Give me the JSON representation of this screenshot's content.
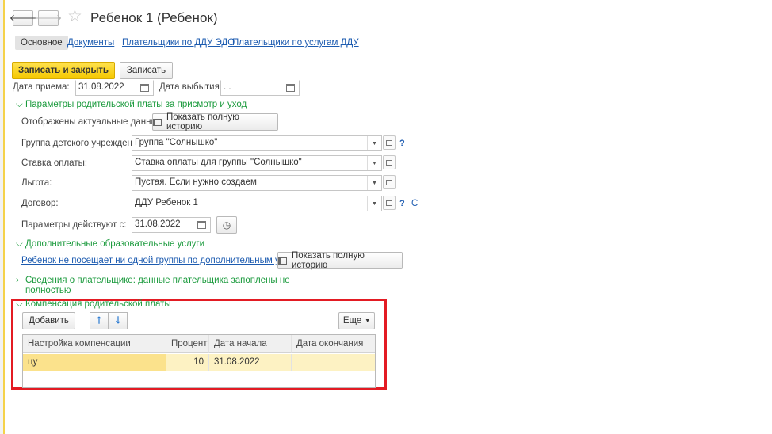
{
  "window": {
    "title": "Ребенок 1 (Ребенок)"
  },
  "nav": {
    "back": "🡐",
    "forward": "🡒"
  },
  "tabs": [
    {
      "label": "Основное"
    },
    {
      "label": "Документы"
    },
    {
      "label": "Плательщики по ДДУ ЭДО"
    },
    {
      "label": "Плательщики по услугам ДДУ"
    }
  ],
  "toolbar": {
    "save_close": "Записать и закрыть",
    "save": "Записать"
  },
  "dates": {
    "admit_label": "Дата приема:",
    "admit_value": "31.08.2022",
    "leave_label": "Дата выбытия:",
    "leave_value": ". ."
  },
  "fee_section": {
    "title": "Параметры родительской платы за присмотр и уход",
    "actual_text": "Отображены актуальные данные",
    "history_btn": "Показать полную историю",
    "group_label": "Группа детского учреждения:",
    "group_value": "Группа \"Солнышко\"",
    "rate_label": "Ставка оплаты:",
    "rate_value": "Ставка оплаты для группы \"Солнышко\"",
    "benefit_label": "Льгота:",
    "benefit_value": "Пустая. Если нужно создаем",
    "contract_label": "Договор:",
    "contract_value": "ДДУ Ребенок 1",
    "contract_link": "Со",
    "params_label": "Параметры действуют с:",
    "params_value": "31.08.2022",
    "help": "?"
  },
  "extra_section": {
    "title": "Дополнительные образовательные услуги",
    "link": "Ребенок не посещает ни одной группы по дополнительным услугам",
    "history_btn": "Показать полную историю"
  },
  "payer_section": {
    "title_line1": "Сведения о плательщике: данные плательщика запоплены не",
    "title_line2": "полностью"
  },
  "compensation": {
    "title": "Компенсация родительской платы",
    "add_btn": "Добавить",
    "more_btn": "Еще",
    "columns": [
      "Настройка компенсации",
      "Процент",
      "Дата начала",
      "Дата окончания"
    ],
    "rows": [
      {
        "setting": "цу",
        "percent": "10",
        "start": "31.08.2022",
        "end": ""
      }
    ]
  },
  "colors": {
    "section": "#1a9a3c",
    "link": "#1c5bb0",
    "primary": "#f5c800",
    "highlight": "#e31b23",
    "row_selected": "#fdf2c3"
  }
}
